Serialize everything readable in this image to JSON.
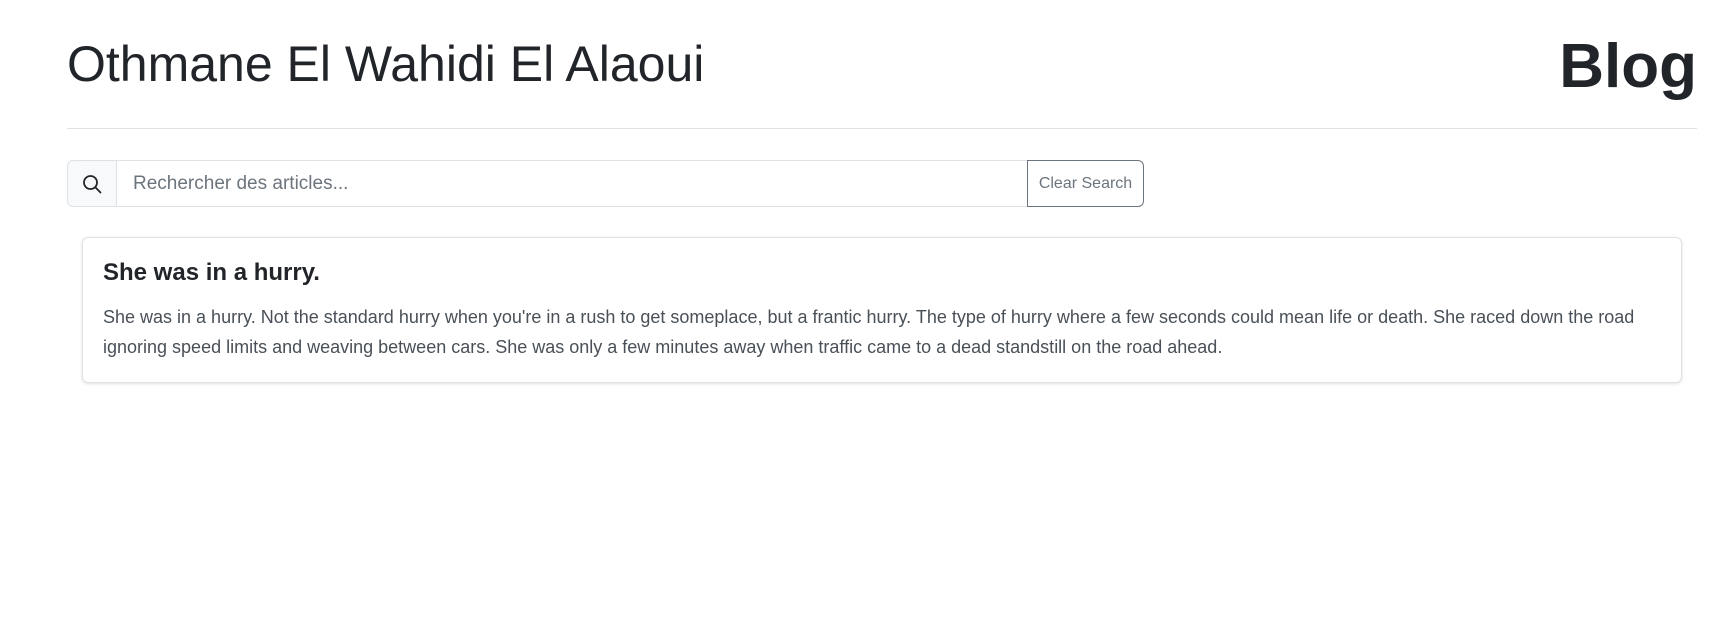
{
  "header": {
    "author_name": "Othmane El Wahidi El Alaoui",
    "blog_title": "Blog"
  },
  "search": {
    "icon": "search-icon",
    "placeholder": "Rechercher des articles...",
    "value": "",
    "clear_label": "Clear Search"
  },
  "articles": [
    {
      "title": "She was in a hurry.",
      "body": "She was in a hurry. Not the standard hurry when you're in a rush to get someplace, but a frantic hurry. The type of hurry where a few seconds could mean life or death. She raced down the road ignoring speed limits and weaving between cars. She was only a few minutes away when traffic came to a dead standstill on the road ahead."
    }
  ],
  "colors": {
    "text": "#212529",
    "muted": "#6c757d",
    "border": "#dee2e6"
  }
}
